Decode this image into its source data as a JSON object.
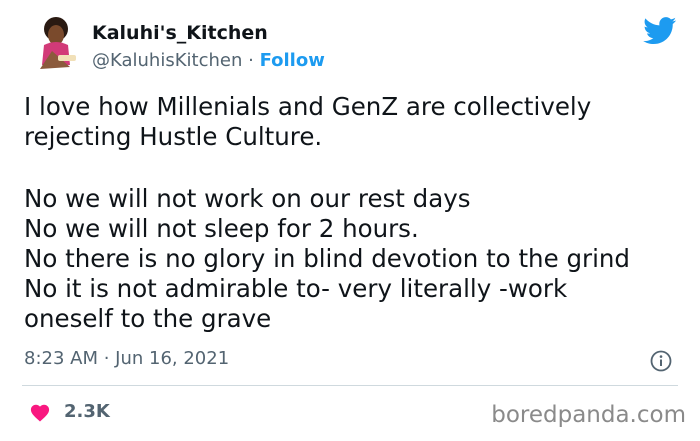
{
  "user": {
    "display_name": "Kaluhi's_Kitchen",
    "handle": "@KaluhisKitchen",
    "separator": "·",
    "follow_label": "Follow"
  },
  "tweet": {
    "lines": [
      "I love how Millenials and GenZ are collectively",
      "rejecting Hustle Culture.",
      "",
      "No we will not work on our rest days",
      "No we will not sleep for 2 hours.",
      "No there is no glory in blind devotion to the grind",
      "No it is not admirable to- very  literally -work",
      "oneself to the grave"
    ],
    "timestamp": "8:23 AM · Jun 16, 2021"
  },
  "engagement": {
    "likes": "2.3K"
  },
  "watermark": "boredpanda.com",
  "colors": {
    "accent": "#1d9bf0",
    "heart": "#f91880",
    "muted_text": "#536471",
    "divider": "#cfd9de"
  },
  "icons": {
    "platform": "twitter-bird-icon",
    "info": "info-icon",
    "like": "heart-icon"
  }
}
